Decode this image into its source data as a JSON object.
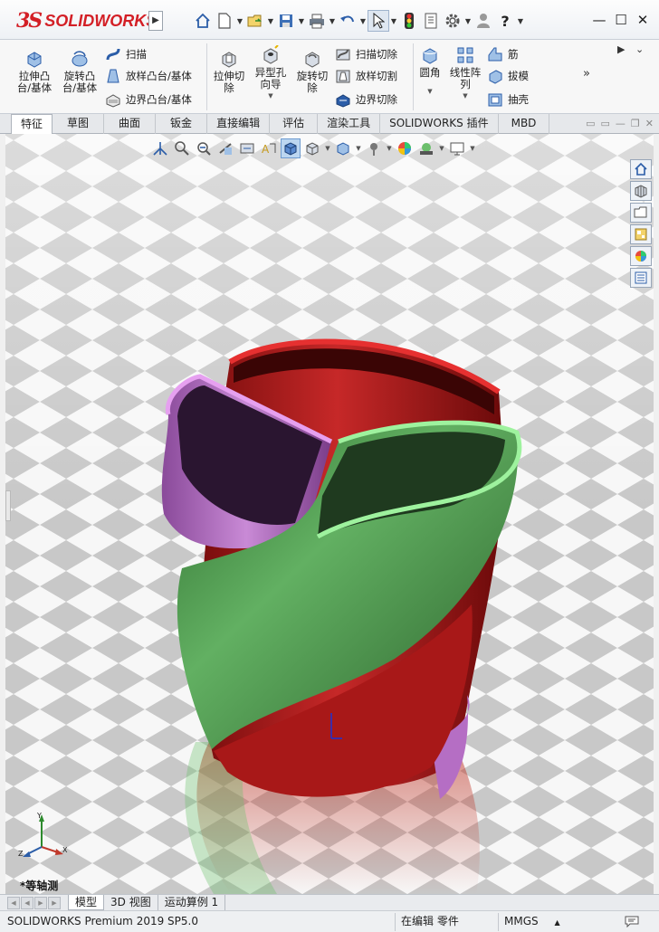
{
  "app": {
    "brand_prefix": "3S",
    "brand_name": "SOLIDWORKS"
  },
  "quick_access": {
    "icons": [
      "home-icon",
      "new-document-icon",
      "open-icon",
      "save-icon",
      "print-icon",
      "undo-icon",
      "select-icon",
      "rebuild-icon",
      "file-properties-icon",
      "options-icon",
      "user-icon",
      "help-icon"
    ]
  },
  "ribbon": {
    "extrude_boss": "拉伸凸\n台/基体",
    "revolve_boss": "旋转凸\n台/基体",
    "sweep": "扫描",
    "loft_boss": "放样凸台/基体",
    "boundary_boss": "边界凸台/基体",
    "extrude_cut": "拉伸切\n除",
    "hole_wizard": "异型孔\n向导",
    "revolve_cut": "旋转切\n除",
    "swept_cut": "扫描切除",
    "lofted_cut": "放样切割",
    "boundary_cut": "边界切除",
    "fillet": "圆角",
    "linear_pattern": "线性阵\n列",
    "rib": "筋",
    "draft": "拔模",
    "shell": "抽壳"
  },
  "tabs": [
    "特征",
    "草图",
    "曲面",
    "钣金",
    "直接编辑",
    "评估",
    "渲染工具",
    "SOLIDWORKS 插件",
    "MBD"
  ],
  "viewport": {
    "view_label": "*等轴测",
    "triad": {
      "x": "X",
      "y": "Y",
      "z": "Z"
    }
  },
  "bottom_tabs": [
    "模型",
    "3D 视图",
    "运动算例 1"
  ],
  "status": {
    "product": "SOLIDWORKS Premium 2019 SP5.0",
    "mode": "在编辑 零件",
    "units": "MMGS"
  },
  "colors": {
    "brand_red": "#d31f26",
    "body_red": "#b51c1c",
    "body_green": "#4e9f4e",
    "body_purple": "#b56ec4",
    "highlight_blue": "#bcd6f1"
  }
}
